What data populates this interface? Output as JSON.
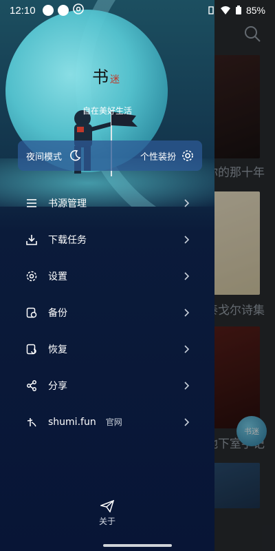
{
  "status_bar": {
    "time": "12:10",
    "battery": "85%"
  },
  "background": {
    "books": [
      {
        "title": "你的那十年"
      },
      {
        "title": "泰戈尔诗集"
      },
      {
        "title": "地下室手记"
      }
    ],
    "float_badge": "书迷"
  },
  "drawer": {
    "logo": {
      "main": "书",
      "accent": "迷"
    },
    "slogan": "自在美好生活",
    "night_mode": {
      "label": "夜间模式",
      "skin_label": "个性装扮"
    },
    "menu": [
      {
        "label": "书源管理",
        "icon": "list-icon"
      },
      {
        "label": "下载任务",
        "icon": "download-icon"
      },
      {
        "label": "设置",
        "icon": "gear-icon"
      },
      {
        "label": "备份",
        "icon": "backup-icon"
      },
      {
        "label": "恢复",
        "icon": "restore-icon"
      },
      {
        "label": "分享",
        "icon": "share-icon"
      },
      {
        "label": "shumi.fun",
        "sub": "官网",
        "icon": "shumi-logo-icon"
      }
    ],
    "about_label": "关于"
  }
}
